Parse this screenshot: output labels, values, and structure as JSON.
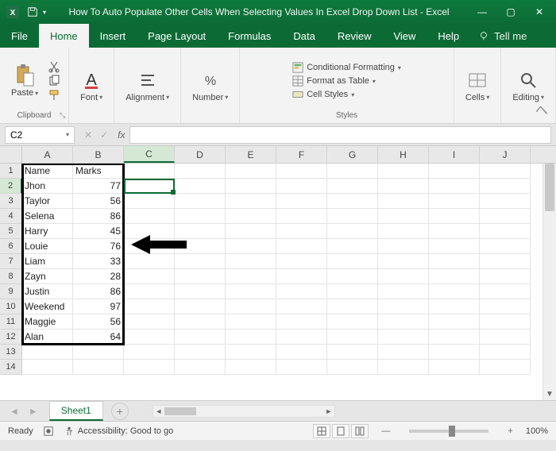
{
  "titlebar": {
    "doc_title": "How To Auto Populate Other Cells When Selecting Values In Excel Drop Down List  -  Excel"
  },
  "tabs": {
    "file": "File",
    "home": "Home",
    "insert": "Insert",
    "page_layout": "Page Layout",
    "formulas": "Formulas",
    "data": "Data",
    "review": "Review",
    "view": "View",
    "help": "Help",
    "tellme": "Tell me"
  },
  "ribbon": {
    "clipboard": {
      "paste": "Paste",
      "label": "Clipboard"
    },
    "font": {
      "label": "Font",
      "btn": "Font"
    },
    "alignment": {
      "label": "Alignment",
      "btn": "Alignment"
    },
    "number": {
      "label": "Number",
      "btn": "Number"
    },
    "styles": {
      "label": "Styles",
      "cond": "Conditional Formatting",
      "table": "Format as Table",
      "cell": "Cell Styles"
    },
    "cells": {
      "label": "Cells",
      "btn": "Cells"
    },
    "editing": {
      "label": "Editing",
      "btn": "Editing"
    }
  },
  "formula_bar": {
    "name_box": "C2",
    "fx": "fx"
  },
  "columns": [
    "A",
    "B",
    "C",
    "D",
    "E",
    "F",
    "G",
    "H",
    "I",
    "J"
  ],
  "selected_col": "C",
  "selected_row": "2",
  "sheet_data": {
    "headers": {
      "a": "Name",
      "b": "Marks"
    },
    "rows": [
      {
        "n": "1",
        "a": "Name",
        "b": "Marks"
      },
      {
        "n": "2",
        "a": "Jhon",
        "b": "77"
      },
      {
        "n": "3",
        "a": "Taylor",
        "b": "56"
      },
      {
        "n": "4",
        "a": "Selena",
        "b": "86"
      },
      {
        "n": "5",
        "a": "Harry",
        "b": "45"
      },
      {
        "n": "6",
        "a": "Louie",
        "b": "76"
      },
      {
        "n": "7",
        "a": "Liam",
        "b": "33"
      },
      {
        "n": "8",
        "a": "Zayn",
        "b": "28"
      },
      {
        "n": "9",
        "a": "Justin",
        "b": "86"
      },
      {
        "n": "10",
        "a": "Weekend",
        "b": "97"
      },
      {
        "n": "11",
        "a": "Maggie",
        "b": "56"
      },
      {
        "n": "12",
        "a": "Alan",
        "b": "64"
      },
      {
        "n": "13",
        "a": "",
        "b": ""
      },
      {
        "n": "14",
        "a": "",
        "b": ""
      }
    ]
  },
  "sheet_tabs": {
    "sheet1": "Sheet1"
  },
  "statusbar": {
    "ready": "Ready",
    "accessibility": "Accessibility: Good to go",
    "zoom": "100%"
  }
}
